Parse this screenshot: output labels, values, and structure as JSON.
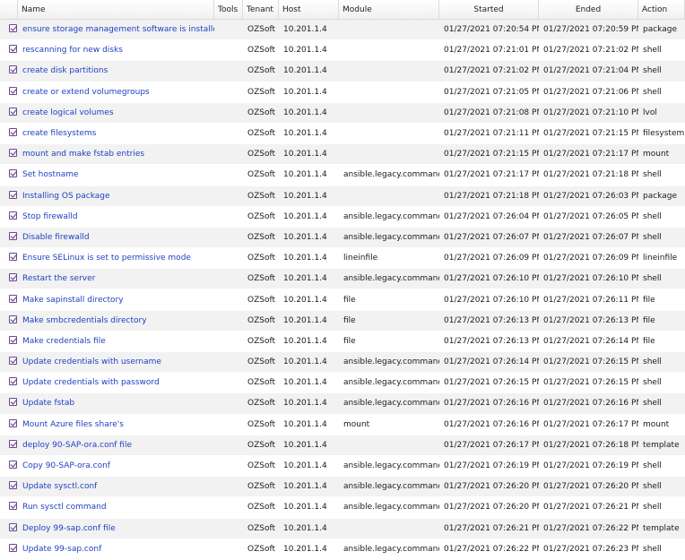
{
  "columns": {
    "name": "Name",
    "tools": "Tools",
    "tenant": "Tenant",
    "host": "Host",
    "module": "Module",
    "started": "Started",
    "ended": "Ended",
    "action": "Action"
  },
  "rows": [
    {
      "name": "ensure storage management software is installed",
      "tenant": "OZSoft",
      "host": "10.201.1.4",
      "module": "",
      "started": "01/27/2021 07:20:54 PM",
      "ended": "01/27/2021 07:20:59 PM",
      "action": "package"
    },
    {
      "name": "rescanning for new disks",
      "tenant": "OZSoft",
      "host": "10.201.1.4",
      "module": "",
      "started": "01/27/2021 07:21:01 PM",
      "ended": "01/27/2021 07:21:02 PM",
      "action": "shell"
    },
    {
      "name": "create disk partitions",
      "tenant": "OZSoft",
      "host": "10.201.1.4",
      "module": "",
      "started": "01/27/2021 07:21:02 PM",
      "ended": "01/27/2021 07:21:04 PM",
      "action": "shell"
    },
    {
      "name": "create or extend volumegroups",
      "tenant": "OZSoft",
      "host": "10.201.1.4",
      "module": "",
      "started": "01/27/2021 07:21:05 PM",
      "ended": "01/27/2021 07:21:06 PM",
      "action": "shell"
    },
    {
      "name": "create logical volumes",
      "tenant": "OZSoft",
      "host": "10.201.1.4",
      "module": "",
      "started": "01/27/2021 07:21:08 PM",
      "ended": "01/27/2021 07:21:10 PM",
      "action": "lvol"
    },
    {
      "name": "create filesystems",
      "tenant": "OZSoft",
      "host": "10.201.1.4",
      "module": "",
      "started": "01/27/2021 07:21:11 PM",
      "ended": "01/27/2021 07:21:15 PM",
      "action": "filesystem"
    },
    {
      "name": "mount and make fstab entries",
      "tenant": "OZSoft",
      "host": "10.201.1.4",
      "module": "",
      "started": "01/27/2021 07:21:15 PM",
      "ended": "01/27/2021 07:21:17 PM",
      "action": "mount"
    },
    {
      "name": "Set hostname",
      "tenant": "OZSoft",
      "host": "10.201.1.4",
      "module": "ansible.legacy.command",
      "started": "01/27/2021 07:21:17 PM",
      "ended": "01/27/2021 07:21:18 PM",
      "action": "shell"
    },
    {
      "name": "Installing OS package",
      "tenant": "OZSoft",
      "host": "10.201.1.4",
      "module": "",
      "started": "01/27/2021 07:21:18 PM",
      "ended": "01/27/2021 07:26:03 PM",
      "action": "package"
    },
    {
      "name": "Stop firewalld",
      "tenant": "OZSoft",
      "host": "10.201.1.4",
      "module": "ansible.legacy.command",
      "started": "01/27/2021 07:26:04 PM",
      "ended": "01/27/2021 07:26:05 PM",
      "action": "shell"
    },
    {
      "name": "Disable firewalld",
      "tenant": "OZSoft",
      "host": "10.201.1.4",
      "module": "ansible.legacy.command",
      "started": "01/27/2021 07:26:07 PM",
      "ended": "01/27/2021 07:26:07 PM",
      "action": "shell"
    },
    {
      "name": "Ensure SELinux is set to permissive mode",
      "tenant": "OZSoft",
      "host": "10.201.1.4",
      "module": "lineinfile",
      "started": "01/27/2021 07:26:09 PM",
      "ended": "01/27/2021 07:26:09 PM",
      "action": "lineinfile"
    },
    {
      "name": "Restart the server",
      "tenant": "OZSoft",
      "host": "10.201.1.4",
      "module": "ansible.legacy.command",
      "started": "01/27/2021 07:26:10 PM",
      "ended": "01/27/2021 07:26:10 PM",
      "action": "shell"
    },
    {
      "name": "Make sapinstall directory",
      "tenant": "OZSoft",
      "host": "10.201.1.4",
      "module": "file",
      "started": "01/27/2021 07:26:10 PM",
      "ended": "01/27/2021 07:26:11 PM",
      "action": "file"
    },
    {
      "name": "Make smbcredentials directory",
      "tenant": "OZSoft",
      "host": "10.201.1.4",
      "module": "file",
      "started": "01/27/2021 07:26:13 PM",
      "ended": "01/27/2021 07:26:13 PM",
      "action": "file"
    },
    {
      "name": "Make credentials file",
      "tenant": "OZSoft",
      "host": "10.201.1.4",
      "module": "file",
      "started": "01/27/2021 07:26:13 PM",
      "ended": "01/27/2021 07:26:14 PM",
      "action": "file"
    },
    {
      "name": "Update credentials with username",
      "tenant": "OZSoft",
      "host": "10.201.1.4",
      "module": "ansible.legacy.command",
      "started": "01/27/2021 07:26:14 PM",
      "ended": "01/27/2021 07:26:15 PM",
      "action": "shell"
    },
    {
      "name": "Update credentials with password",
      "tenant": "OZSoft",
      "host": "10.201.1.4",
      "module": "ansible.legacy.command",
      "started": "01/27/2021 07:26:15 PM",
      "ended": "01/27/2021 07:26:15 PM",
      "action": "shell"
    },
    {
      "name": "Update fstab",
      "tenant": "OZSoft",
      "host": "10.201.1.4",
      "module": "ansible.legacy.command",
      "started": "01/27/2021 07:26:16 PM",
      "ended": "01/27/2021 07:26:16 PM",
      "action": "shell"
    },
    {
      "name": "Mount Azure files share's",
      "tenant": "OZSoft",
      "host": "10.201.1.4",
      "module": "mount",
      "started": "01/27/2021 07:26:16 PM",
      "ended": "01/27/2021 07:26:17 PM",
      "action": "mount"
    },
    {
      "name": "deploy 90-SAP-ora.conf file",
      "tenant": "OZSoft",
      "host": "10.201.1.4",
      "module": "",
      "started": "01/27/2021 07:26:17 PM",
      "ended": "01/27/2021 07:26:18 PM",
      "action": "template"
    },
    {
      "name": "Copy 90-SAP-ora.conf",
      "tenant": "OZSoft",
      "host": "10.201.1.4",
      "module": "ansible.legacy.command",
      "started": "01/27/2021 07:26:19 PM",
      "ended": "01/27/2021 07:26:19 PM",
      "action": "shell"
    },
    {
      "name": "Update sysctl.conf",
      "tenant": "OZSoft",
      "host": "10.201.1.4",
      "module": "ansible.legacy.command",
      "started": "01/27/2021 07:26:20 PM",
      "ended": "01/27/2021 07:26:20 PM",
      "action": "shell"
    },
    {
      "name": "Run sysctl command",
      "tenant": "OZSoft",
      "host": "10.201.1.4",
      "module": "ansible.legacy.command",
      "started": "01/27/2021 07:26:20 PM",
      "ended": "01/27/2021 07:26:21 PM",
      "action": "shell"
    },
    {
      "name": "Deploy 99-sap.conf file",
      "tenant": "OZSoft",
      "host": "10.201.1.4",
      "module": "",
      "started": "01/27/2021 07:26:21 PM",
      "ended": "01/27/2021 07:26:22 PM",
      "action": "template"
    },
    {
      "name": "Update 99-sap.conf",
      "tenant": "OZSoft",
      "host": "10.201.1.4",
      "module": "ansible.legacy.command",
      "started": "01/27/2021 07:26:22 PM",
      "ended": "01/27/2021 07:26:23 PM",
      "action": "shell"
    }
  ]
}
